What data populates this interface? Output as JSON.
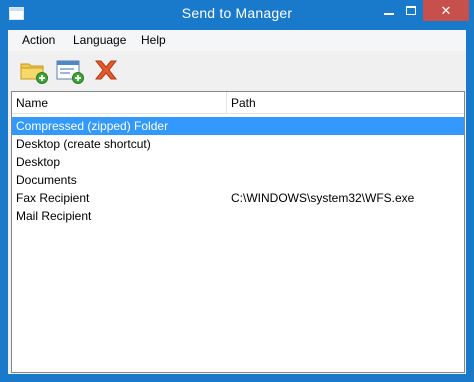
{
  "window": {
    "title": "Send to Manager",
    "minimize_glyph": "minimize-icon",
    "maximize_glyph": "maximize-icon",
    "close_glyph": "✕"
  },
  "menu": [
    "Action",
    "Language",
    "Help"
  ],
  "toolbar": {
    "buttons": [
      "add-folder-icon",
      "add-item-icon",
      "delete-icon"
    ]
  },
  "columns": {
    "name": "Name",
    "path": "Path"
  },
  "rows": [
    {
      "name": "Compressed (zipped) Folder",
      "path": "",
      "selected": true
    },
    {
      "name": "Desktop (create shortcut)",
      "path": "",
      "selected": false
    },
    {
      "name": "Desktop",
      "path": "",
      "selected": false
    },
    {
      "name": "Documents",
      "path": "",
      "selected": false
    },
    {
      "name": "Fax Recipient",
      "path": "C:\\WINDOWS\\system32\\WFS.exe",
      "selected": false
    },
    {
      "name": "Mail Recipient",
      "path": "",
      "selected": false
    }
  ],
  "colors": {
    "titlebar": "#1979ca",
    "close": "#c7504c",
    "selection": "#3399ff"
  }
}
